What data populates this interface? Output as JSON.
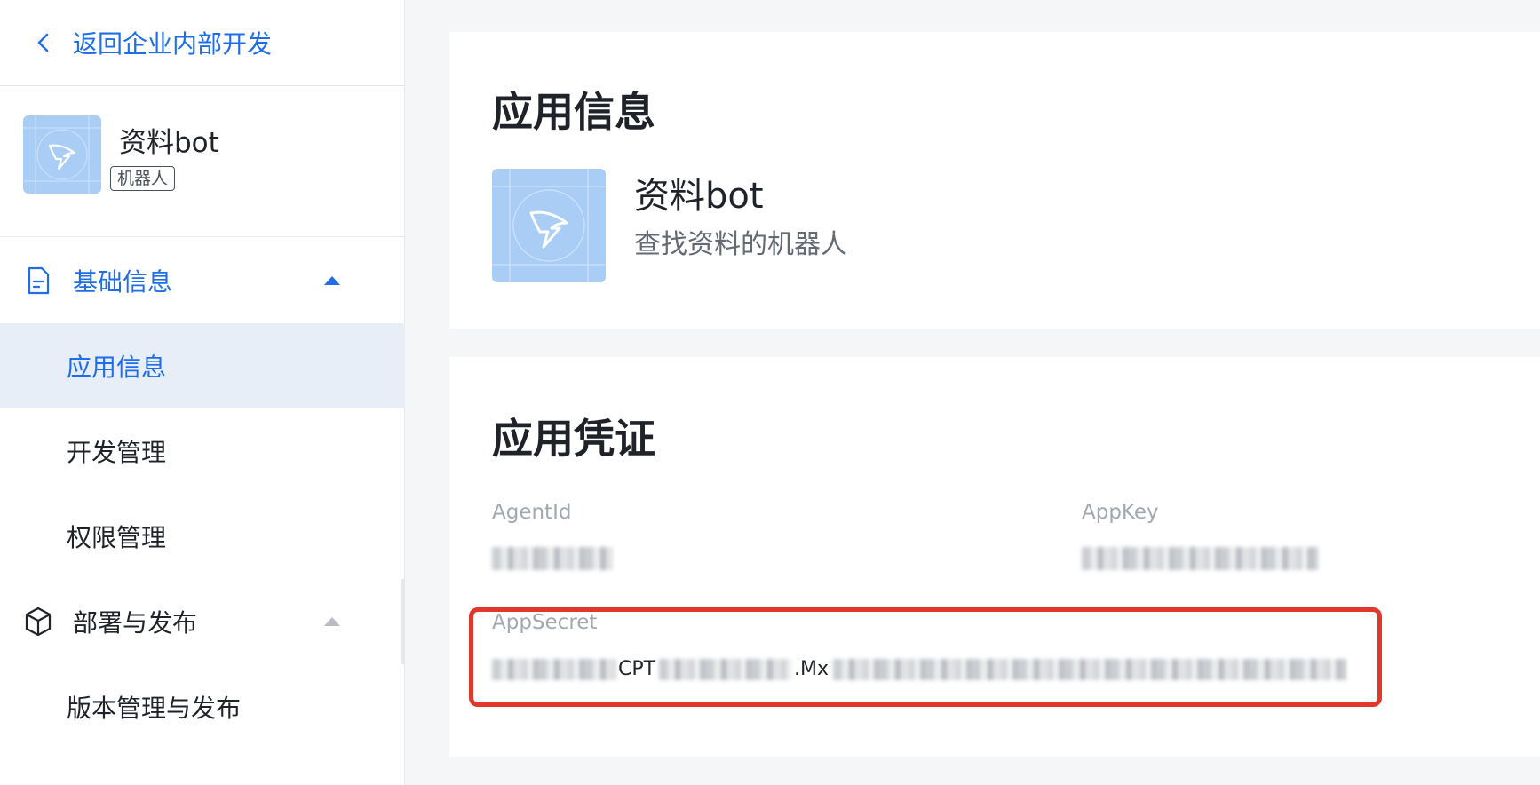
{
  "sidebar": {
    "back_label": "返回企业内部开发",
    "app": {
      "name": "资料bot",
      "badge": "机器人"
    },
    "groups": [
      {
        "label": "基础信息",
        "expanded": true,
        "items": [
          {
            "label": "应用信息",
            "active": true
          },
          {
            "label": "开发管理"
          },
          {
            "label": "权限管理"
          }
        ]
      },
      {
        "label": "部署与发布",
        "expanded": true,
        "items": [
          {
            "label": "版本管理与发布"
          }
        ]
      }
    ]
  },
  "main": {
    "app_info": {
      "title": "应用信息",
      "name": "资料bot",
      "description": "查找资料的机器人"
    },
    "credentials": {
      "title": "应用凭证",
      "agent_id": {
        "label": "AgentId",
        "value": ""
      },
      "app_key": {
        "label": "AppKey",
        "value": ""
      },
      "app_secret": {
        "label": "AppSecret",
        "visible_fragments": [
          "CPT",
          ".Mx"
        ]
      }
    }
  },
  "colors": {
    "accent": "#1f6ee8",
    "active_bg": "#e8eef8",
    "highlight": "#e0392b",
    "logo_bg": "#a9cdf5"
  }
}
